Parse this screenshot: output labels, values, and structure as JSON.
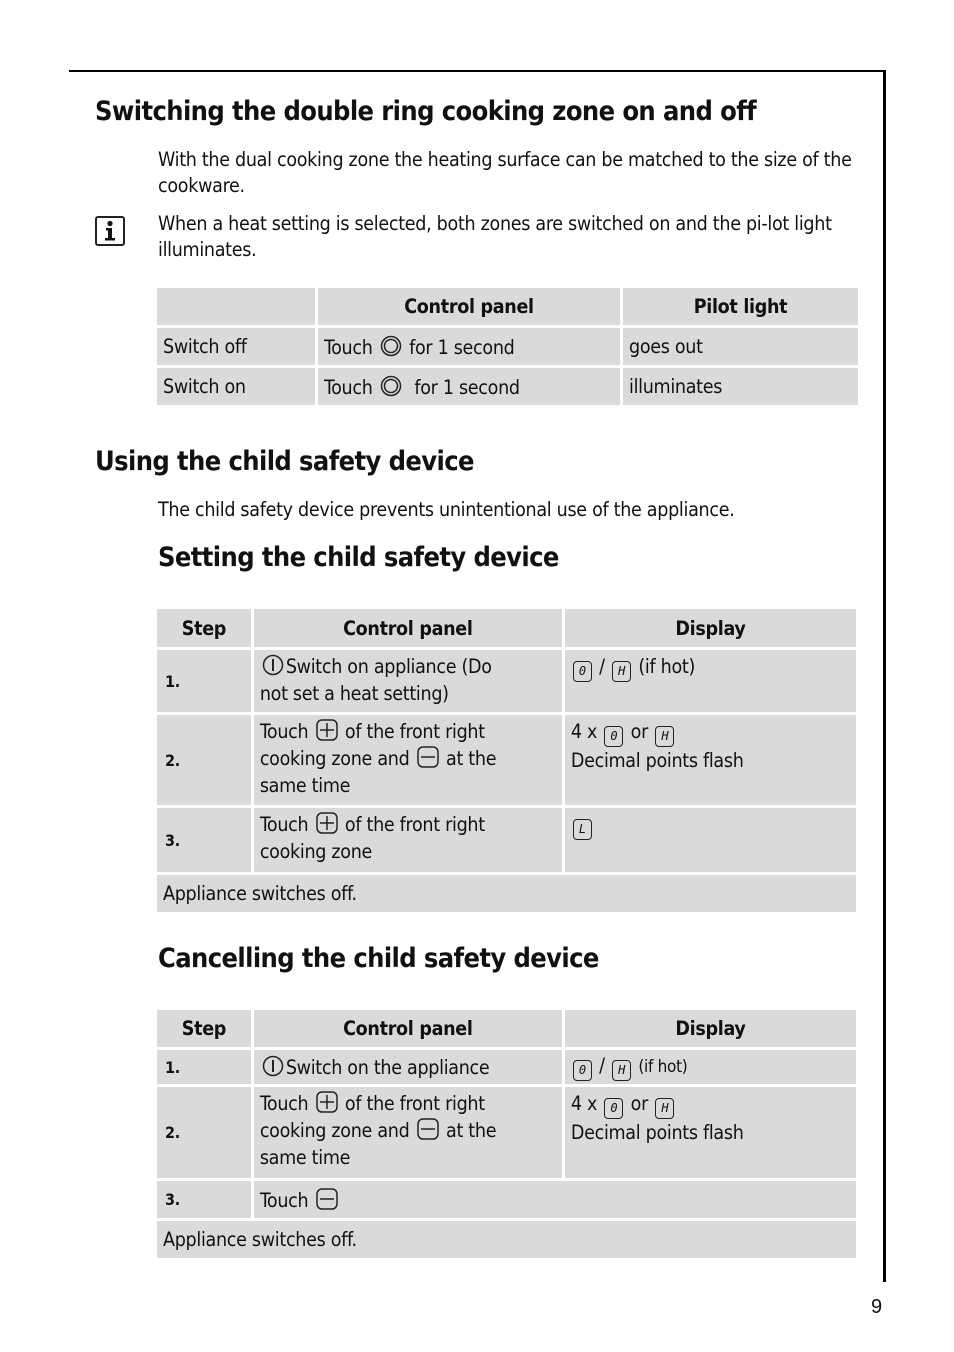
{
  "page_number": "9",
  "section1": {
    "title": "Switching the double ring cooking zone on and off",
    "intro": "With the dual cooking zone the heating surface can be matched to the size of the cookware.",
    "info_note": "When a heat setting is selected, both zones are switched on and the pi-lot light illuminates.",
    "table": {
      "headers": [
        "",
        "Control panel",
        "Pilot light"
      ],
      "rows": [
        {
          "action": "Switch off",
          "control_pre": "Touch",
          "control_icon": "dual-ring-icon",
          "control_post": "for 1 second",
          "pilot": "goes out"
        },
        {
          "action": "Switch on",
          "control_pre": "Touch",
          "control_icon": "dual-ring-icon",
          "control_post": " for 1 second",
          "pilot": "illuminates"
        }
      ]
    }
  },
  "section2": {
    "title": "Using the child safety device",
    "intro": "The child safety device prevents unintentional use of the appliance."
  },
  "section3": {
    "title": "Setting the child safety device",
    "table": {
      "headers": [
        "Step",
        "Control panel",
        "Display"
      ],
      "rows": [
        {
          "step": "1.",
          "control": [
            "Switch on appliance (Do",
            "not set a heat setting)"
          ],
          "display_a": "0",
          "display_sep": "/",
          "display_b": "H",
          "display_post": "(if hot)"
        },
        {
          "step": "2.",
          "control": [
            "Touch",
            "of the front right",
            "cooking zone and",
            "at the",
            "same time"
          ],
          "display_pre": "4 x",
          "display_a": "0",
          "display_sep": "or",
          "display_b": "H",
          "display_line2": "Decimal points flash"
        },
        {
          "step": "3.",
          "control": [
            "Touch",
            "of the front right",
            "cooking zone"
          ],
          "display_a": "L"
        }
      ],
      "footer": "Appliance switches off."
    }
  },
  "section4": {
    "title": "Cancelling the child safety device",
    "table": {
      "headers": [
        "Step",
        "Control panel",
        "Display"
      ],
      "rows": [
        {
          "step": "1.",
          "control": [
            "Switch on the appliance"
          ],
          "display_a": "0",
          "display_sep": "/",
          "display_b": "H",
          "display_post": "(if hot)"
        },
        {
          "step": "2.",
          "control": [
            "Touch",
            "of the front right",
            "cooking zone and",
            "at the",
            "same time"
          ],
          "display_pre": "4 x",
          "display_a": "0",
          "display_sep": "or",
          "display_b": "H",
          "display_line2": "Decimal points flash"
        },
        {
          "step": "3.",
          "control": [
            "Touch"
          ]
        }
      ],
      "footer": "Appliance switches off."
    }
  }
}
